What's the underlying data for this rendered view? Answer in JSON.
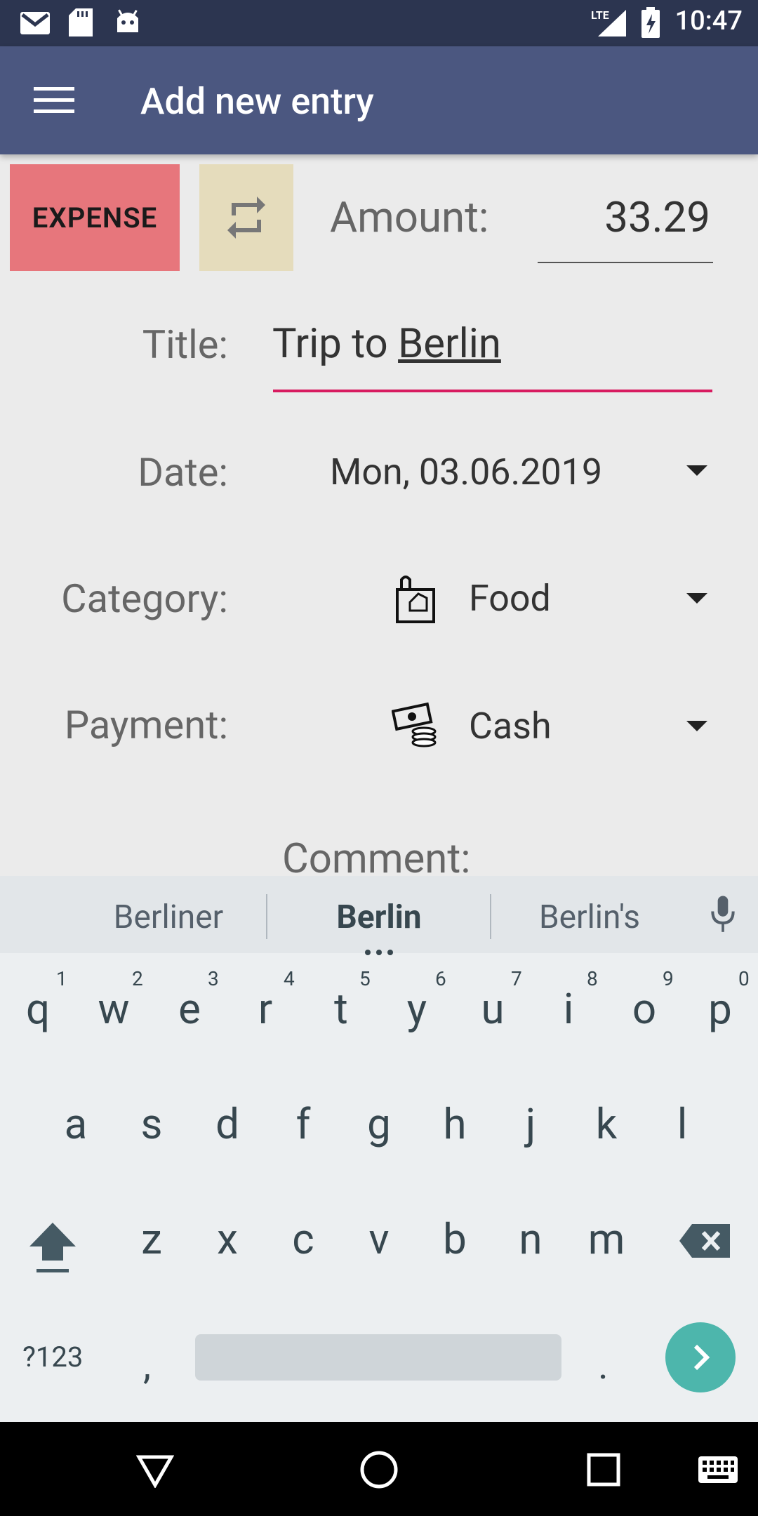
{
  "status": {
    "time": "10:47",
    "network": "LTE"
  },
  "appbar": {
    "title": "Add new entry"
  },
  "form": {
    "type_button": "EXPENSE",
    "amount_label": "Amount:",
    "amount_value": "33.29",
    "title_label": "Title:",
    "title_value_prefix": "Trip to ",
    "title_value_word": "Berlin",
    "date_label": "Date:",
    "date_value": "Mon, 03.06.2019",
    "category_label": "Category:",
    "category_value": "Food",
    "payment_label": "Payment:",
    "payment_value": "Cash",
    "comment_label": "Comment:"
  },
  "keyboard": {
    "suggestions": [
      "Berliner",
      "Berlin",
      "Berlin's"
    ],
    "row1": [
      "q",
      "w",
      "e",
      "r",
      "t",
      "y",
      "u",
      "i",
      "o",
      "p"
    ],
    "row1_hints": [
      "1",
      "2",
      "3",
      "4",
      "5",
      "6",
      "7",
      "8",
      "9",
      "0"
    ],
    "row2": [
      "a",
      "s",
      "d",
      "f",
      "g",
      "h",
      "j",
      "k",
      "l"
    ],
    "row3": [
      "z",
      "x",
      "c",
      "v",
      "b",
      "n",
      "m"
    ],
    "symbols_key": "?123",
    "comma_key": ",",
    "period_key": "."
  },
  "colors": {
    "appbar": "#4b5780",
    "expense": "#e7767c",
    "accent": "#d81b60",
    "enter": "#4db6ac"
  }
}
